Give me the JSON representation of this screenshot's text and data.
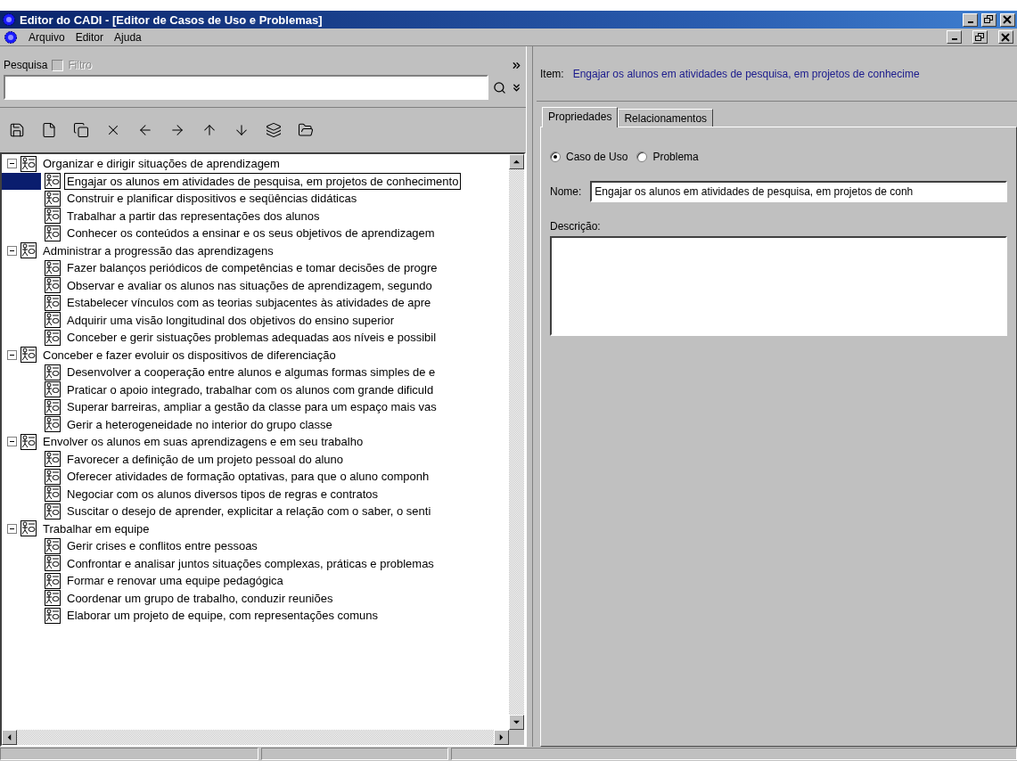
{
  "window": {
    "title": "Editor do CADI - [Editor de Casos de Uso e Problemas]"
  },
  "menu": [
    {
      "label": "Arquivo"
    },
    {
      "label": "Editor"
    },
    {
      "label": "Ajuda"
    }
  ],
  "search": {
    "label": "Pesquisa",
    "filter": {
      "label": "Filtro",
      "checked": false,
      "disabled": true
    }
  },
  "tree": [
    {
      "label": "Organizar e dirigir situações de aprendizagem",
      "expanded": true,
      "selected": false,
      "children": [
        {
          "label": "Engajar os alunos em atividades de pesquisa, em projetos de conhecimento",
          "selected": true
        },
        {
          "label": "Construir e planificar dispositivos e seqüências didáticas",
          "selected": false
        },
        {
          "label": "Trabalhar a partir das representações dos alunos",
          "selected": false
        },
        {
          "label": "Conhecer os conteúdos a ensinar e os seus objetivos de aprendizagem",
          "selected": false
        }
      ]
    },
    {
      "label": "Administrar a progressão das aprendizagens",
      "expanded": true,
      "selected": false,
      "children": [
        {
          "label": "Fazer balanços periódicos de competências e tomar decisões de progre",
          "selected": false
        },
        {
          "label": "Observar e avaliar os alunos nas situações de aprendizagem, segundo",
          "selected": false
        },
        {
          "label": "Estabelecer vínculos com as teorias subjacentes às atividades de apre",
          "selected": false
        },
        {
          "label": "Adquirir uma visão longitudinal dos objetivos do ensino superior",
          "selected": false
        },
        {
          "label": "Conceber e gerir sistuações problemas adequadas aos níveis e possibil",
          "selected": false
        }
      ]
    },
    {
      "label": "Conceber e fazer evoluir os dispositivos de diferenciação",
      "expanded": true,
      "selected": false,
      "children": [
        {
          "label": "Desenvolver a cooperação entre alunos e algumas formas simples de e",
          "selected": false
        },
        {
          "label": "Praticar o apoio integrado, trabalhar com os alunos com grande dificuld",
          "selected": false
        },
        {
          "label": "Superar barreiras, ampliar a gestão da classe para um espaço mais vas",
          "selected": false
        },
        {
          "label": "Gerir a heterogeneidade no interior do grupo classe",
          "selected": false
        }
      ]
    },
    {
      "label": "Envolver os alunos em suas aprendizagens e em seu trabalho",
      "expanded": true,
      "selected": false,
      "children": [
        {
          "label": "Favorecer a definição de um projeto pessoal do aluno",
          "selected": false
        },
        {
          "label": "Oferecer atividades de formação optativas, para que o aluno componh",
          "selected": false
        },
        {
          "label": "Negociar com os alunos diversos tipos de regras e contratos",
          "selected": false
        },
        {
          "label": "Suscitar o desejo de aprender, explicitar a relação com o saber, o senti",
          "selected": false
        }
      ]
    },
    {
      "label": "Trabalhar em equipe",
      "expanded": true,
      "selected": false,
      "children": [
        {
          "label": "Gerir crises e conflitos entre pessoas",
          "selected": false
        },
        {
          "label": "Confrontar e analisar juntos situações complexas, práticas e problemas",
          "selected": false
        },
        {
          "label": "Formar e renovar uma equipe pedagógica",
          "selected": false
        },
        {
          "label": "Coordenar um grupo de trabalho, conduzir reuniões",
          "selected": false
        },
        {
          "label": "Elaborar um projeto de equipe, com representações comuns",
          "selected": false
        }
      ]
    }
  ],
  "item": {
    "label": "Item:",
    "value": "Engajar os alunos em atividades de pesquisa, em projetos de conhecime"
  },
  "tabs": [
    {
      "label": "Propriedades",
      "selected": true
    },
    {
      "label": "Relacionamentos",
      "selected": false
    }
  ],
  "type_options": [
    {
      "label": "Caso de Uso",
      "selected": true
    },
    {
      "label": "Problema",
      "selected": false
    }
  ],
  "name_field": {
    "label": "Nome:",
    "value": "Engajar os alunos em atividades de pesquisa, em projetos de conh"
  },
  "description_field": {
    "label": "Descrição:"
  }
}
